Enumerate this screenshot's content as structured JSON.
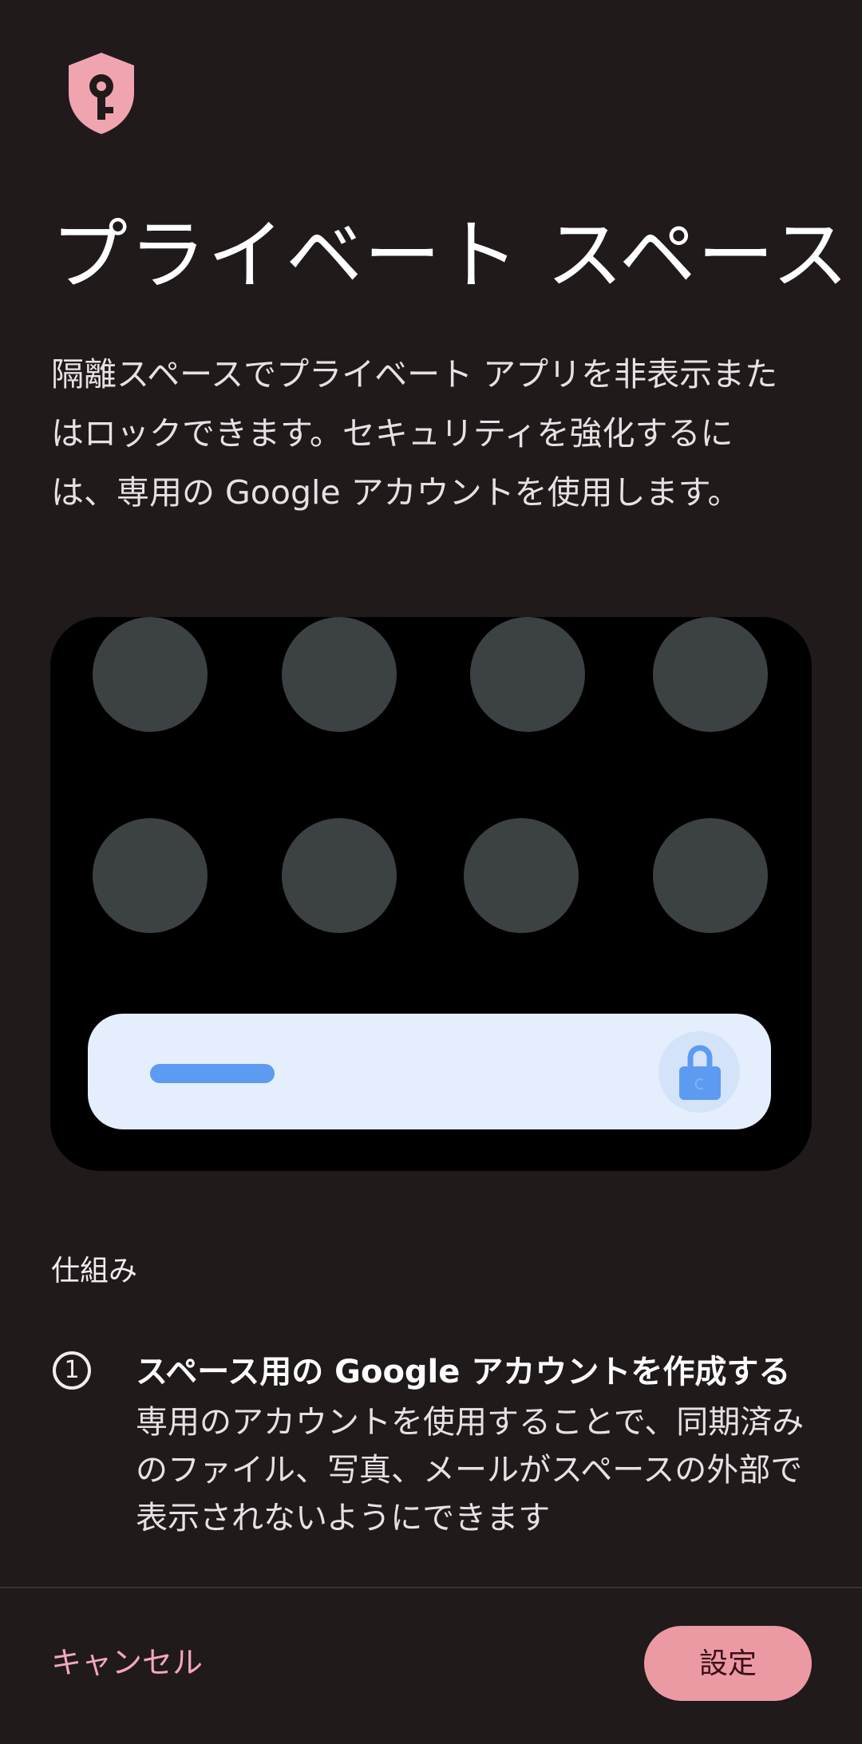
{
  "header": {
    "icon": "shield-key-icon",
    "accent": "#f0a4b0",
    "title": "プライベート スペース"
  },
  "description": "隔離スペースでプライベート アプリを非表示またはロックできます。セキュリティを強化するには、専用の Google アカウントを使用します。",
  "illustration": {
    "lock_icon": "lock-icon"
  },
  "how_it_works": {
    "label": "仕組み",
    "steps": [
      {
        "number": "1",
        "title": "スペース用の Google アカウントを作成する",
        "description": "専用のアカウントを使用することで、同期済みのファイル、写真、メールがスペースの外部で表示されないようにできます"
      }
    ]
  },
  "footer": {
    "cancel_label": "キャンセル",
    "setup_label": "設定"
  }
}
